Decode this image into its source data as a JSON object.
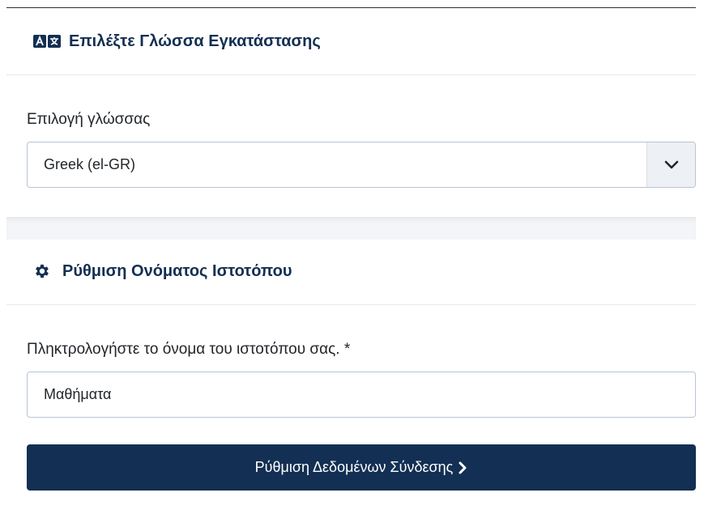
{
  "language_section": {
    "title": "Επιλέξτε Γλώσσα Εγκατάστασης",
    "icon": "language-icon",
    "field_label": "Επιλογή γλώσσας",
    "selected_value": "Greek (el-GR)",
    "arrow_icon": "chevron-down-icon"
  },
  "site_section": {
    "title": "Ρύθμιση Ονόματος Ιστοτόπου",
    "icon": "gear-icon",
    "field_label": "Πληκτρολογήστε το όνομα του ιστοτόπου σας. *",
    "site_name_value": "Μαθήματα"
  },
  "actions": {
    "next_button_label": "Ρύθμιση Δεδομένων Σύνδεσης",
    "next_icon": "chevron-right-icon"
  },
  "colors": {
    "heading": "#132f53",
    "button_bg": "#132f53",
    "input_border": "#b9c4d3"
  }
}
